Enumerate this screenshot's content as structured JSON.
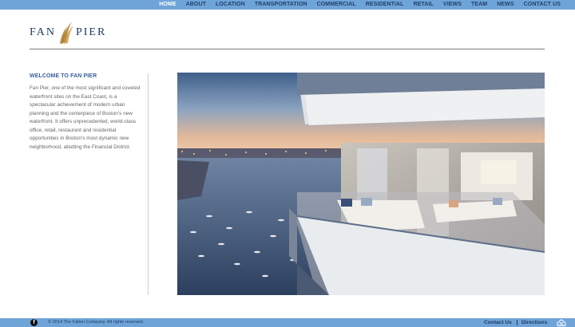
{
  "nav": {
    "items": [
      "HOME",
      "ABOUT",
      "LOCATION",
      "TRANSPORTATION",
      "COMMERCIAL",
      "RESIDENTIAL",
      "RETAIL",
      "VIEWS",
      "TEAM",
      "NEWS",
      "CONTACT US"
    ],
    "active": "HOME"
  },
  "logo": {
    "left": "FAN",
    "right": "PIER",
    "icon": "feather-icon"
  },
  "welcome": {
    "heading": "WELCOME TO FAN PIER",
    "body": "Fan Pier, one of the most significant and coveted waterfront sites on the East Coast, is a spectacular achievement of modern urban planning and the centerpiece of Boston’s new waterfront. It offers unprecedented, world-class office, retail, restaurant and residential opportunities in Boston’s most dynamic new neighborhood, abutting the Financial District."
  },
  "hero": {
    "description_icon": "waterfront-balcony-photo"
  },
  "footer": {
    "copyright": "© 2014 The Fallon Company. All rights reserved.",
    "contact": "Contact Us",
    "directions": "Directions",
    "facebook_icon": "facebook-icon",
    "equal_housing_icon": "equal-housing-icon"
  },
  "colors": {
    "bar": "#6fa4d8",
    "navy": "#1f3a63",
    "gold": "#b8893b",
    "heading": "#3b5f9a"
  }
}
